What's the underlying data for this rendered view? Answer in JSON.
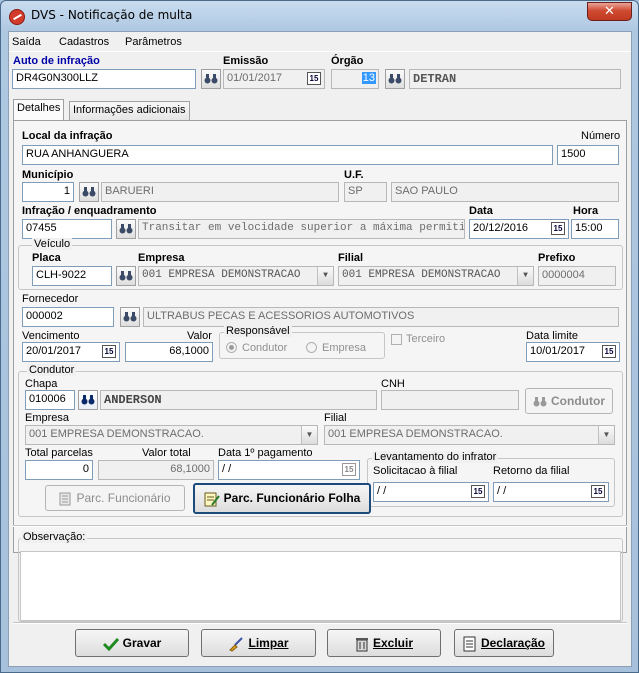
{
  "window": {
    "title": "DVS - Notificação de multa",
    "close_label": "✕"
  },
  "menu": [
    "Saída",
    "Cadastros",
    "Parâmetros"
  ],
  "header": {
    "auto_label": "Auto de infração",
    "auto_value": "DR4G0N300LLZ",
    "emissao_label": "Emissão",
    "emissao_value": "01/01/2017",
    "orgao_label": "Órgão",
    "orgao_code": "13",
    "orgao_name": "DETRAN"
  },
  "tabs": [
    "Detalhes",
    "Informações adicionais"
  ],
  "local": {
    "label": "Local da infração",
    "value": "RUA ANHANGUERA",
    "numero_label": "Número",
    "numero_value": "1500"
  },
  "municipio": {
    "label": "Município",
    "code": "1",
    "name": "BARUERI",
    "uf_label": "U.F.",
    "uf_code": "SP",
    "uf_name": "SAO PAULO"
  },
  "infracao": {
    "label": "Infração / enquadramento",
    "code": "07455",
    "description": "Transitar em velocidade superior a máxima permitida para",
    "data_label": "Data",
    "data_value": "20/12/2016",
    "hora_label": "Hora",
    "hora_value": "15:00"
  },
  "veiculo": {
    "group_label": "Veículo",
    "placa_label": "Placa",
    "placa_value": "CLH-9022",
    "empresa_label": "Empresa",
    "empresa_value": "001 EMPRESA DEMONSTRACAO",
    "filial_label": "Filial",
    "filial_value": "001 EMPRESA DEMONSTRACAO",
    "prefixo_label": "Prefixo",
    "prefixo_value": "0000004"
  },
  "fornecedor": {
    "label": "Fornecedor",
    "code": "000002",
    "name": "ULTRABUS PECAS E ACESSORIOS AUTOMOTIVOS"
  },
  "pagamento": {
    "vencimento_label": "Vencimento",
    "vencimento_value": "20/01/2017",
    "valor_label": "Valor",
    "valor_value": "68,1000",
    "responsavel_label": "Responsável",
    "condutor_option": "Condutor",
    "empresa_option": "Empresa",
    "terceiro_label": "Terceiro",
    "data_limite_label": "Data limite",
    "data_limite_value": "10/01/2017"
  },
  "condutor": {
    "group_label": "Condutor",
    "chapa_label": "Chapa",
    "chapa_value": "010006",
    "chapa_name": "ANDERSON",
    "cnh_label": "CNH",
    "cnh_value": "",
    "condutor_button": "Condutor",
    "empresa_label": "Empresa",
    "empresa_value": "001 EMPRESA DEMONSTRACAO.",
    "filial_label": "Filial",
    "filial_value": "001 EMPRESA DEMONSTRACAO.",
    "total_parcelas_label": "Total parcelas",
    "total_parcelas_value": "0",
    "valor_total_label": "Valor total",
    "valor_total_value": "68,1000",
    "data_pagamento_label": "Data 1º pagamento",
    "data_pagamento_value": " / /",
    "levantamento_label": "Levantamento do infrator",
    "solicitacao_label": "Solicitacao à filial",
    "solicitacao_value": " / /",
    "retorno_label": "Retorno da filial",
    "retorno_value": " / /",
    "parc_funcionario": "Parc. Funcionário",
    "parc_funcionario_folha": "Parc. Funcionário Folha"
  },
  "observacao": {
    "label": "Observação:",
    "value": ""
  },
  "actions": {
    "gravar": "Gravar",
    "limpar": "Limpar",
    "excluir": "Excluir",
    "declaracao": "Declaração"
  }
}
